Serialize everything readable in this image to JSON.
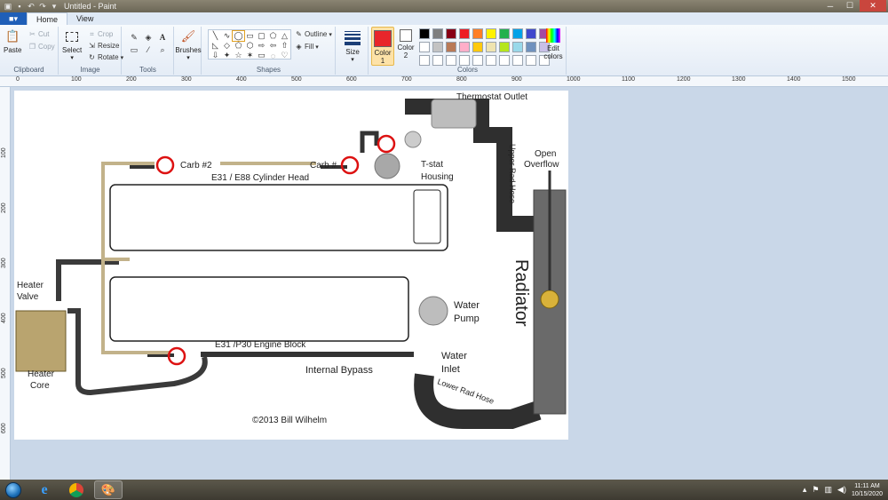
{
  "window": {
    "title": "Untitled - Paint"
  },
  "tabs": {
    "file_label": "■▾",
    "home": "Home",
    "view": "View"
  },
  "clipboard": {
    "paste": "Paste",
    "cut": "Cut",
    "copy": "Copy",
    "label": "Clipboard"
  },
  "image": {
    "select": "Select",
    "crop": "Crop",
    "resize": "Resize",
    "rotate": "Rotate",
    "label": "Image"
  },
  "tools": {
    "label": "Tools"
  },
  "brushes": {
    "label": "Brushes"
  },
  "shapes": {
    "outline": "Outline",
    "fill": "Fill",
    "label": "Shapes"
  },
  "size": {
    "label": "Size"
  },
  "colors": {
    "color1_label": "Color",
    "color1_num": "1",
    "color2_label": "Color",
    "color2_num": "2",
    "edit_colors": "Edit",
    "edit_colors2": "colors",
    "label": "Colors",
    "color1": "#e8262b",
    "color2": "#ffffff",
    "palette": [
      "#000000",
      "#7f7f7f",
      "#880015",
      "#ed1c24",
      "#ff7f27",
      "#fff200",
      "#22b14c",
      "#00a2e8",
      "#3f48cc",
      "#a349a4",
      "#ffffff",
      "#c3c3c3",
      "#b97a57",
      "#ffaec9",
      "#ffc90e",
      "#efe4b0",
      "#b5e61d",
      "#99d9ea",
      "#7092be",
      "#c8bfe7",
      "#ffffff",
      "#ffffff",
      "#ffffff",
      "#ffffff",
      "#ffffff",
      "#ffffff",
      "#ffffff",
      "#ffffff",
      "#ffffff",
      "#ffffff"
    ]
  },
  "ruler": {
    "marks": [
      "0",
      "100",
      "200",
      "300",
      "400",
      "500",
      "600",
      "700",
      "800",
      "900",
      "1000",
      "1100",
      "1200",
      "1300",
      "1400",
      "1500"
    ],
    "vmarks": [
      "100",
      "200",
      "300",
      "400",
      "500",
      "600"
    ]
  },
  "diagram": {
    "thermostat_outlet": "Thermostat Outlet",
    "upper_rad_hose": "Upper Rad Hose",
    "open": "Open",
    "overflow": "Overflow",
    "carb2": "Carb #2",
    "carb1": "Carb #",
    "tstat": "T-stat",
    "housing": "Housing",
    "cylinder_head": "E31 / E88 Cylinder Head",
    "heater": "Heater",
    "valve": "Valve",
    "heater2": "Heater",
    "core": "Core",
    "water": "Water",
    "pump": "Pump",
    "radiator": "Radiator",
    "engine_block": "E31 /P30 Engine Block",
    "internal_bypass": "Internal Bypass",
    "water2": "Water",
    "inlet": "Inlet",
    "lower_rad_hose": "Lower Rad Hose",
    "copyright": "©2013 Bill Wilhelm"
  },
  "taskbar": {
    "time": "11:11 AM",
    "date": "10/15/2020"
  }
}
